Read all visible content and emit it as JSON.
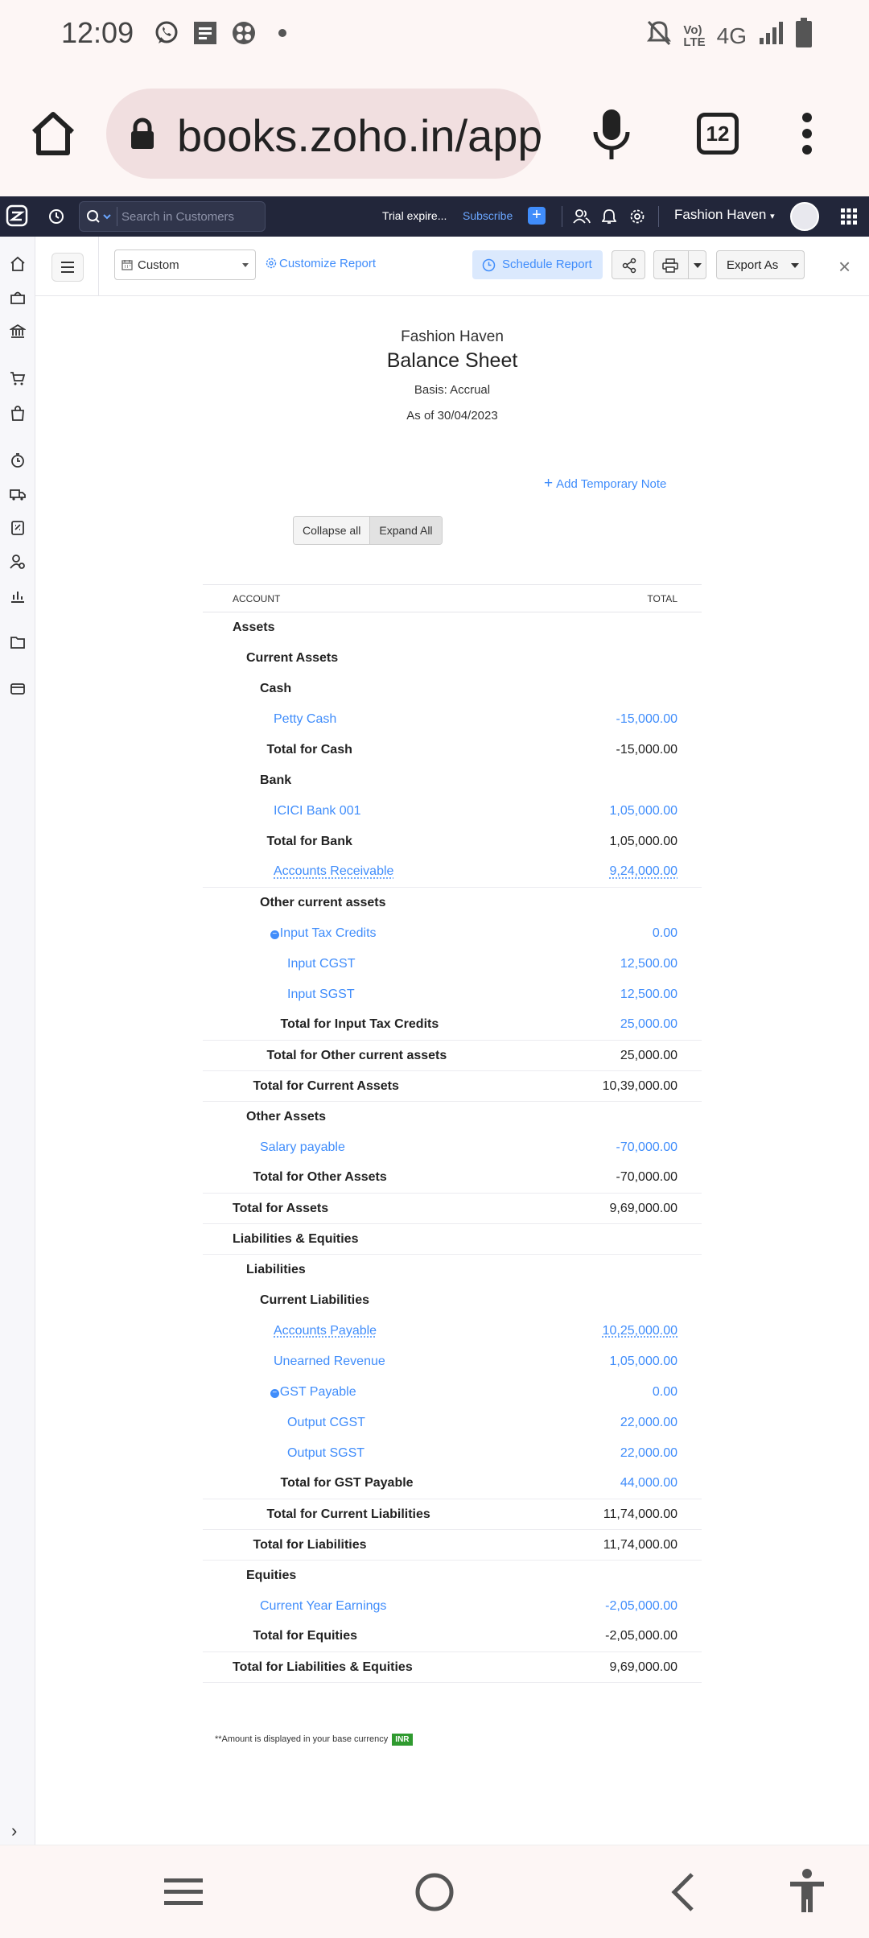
{
  "status_bar": {
    "time": "12:09",
    "network": "4G"
  },
  "browser": {
    "url": "books.zoho.in/app",
    "tab_count": "12"
  },
  "topbar": {
    "search_placeholder": "Search in Customers",
    "trial": "Trial expire...",
    "subscribe": "Subscribe",
    "org_name": "Fashion Haven"
  },
  "toolbar": {
    "period": "Custom",
    "customize": "Customize Report",
    "schedule": "Schedule Report",
    "export": "Export As"
  },
  "report": {
    "org": "Fashion Haven",
    "title": "Balance Sheet",
    "basis": "Basis: Accrual",
    "as_of": "As of 30/04/2023",
    "add_note": "Add Temporary Note",
    "collapse_all": "Collapse all",
    "expand_all": "Expand All",
    "col_account": "Account",
    "col_total": "Total",
    "footnote": "**Amount is displayed in your base currency",
    "currency": "INR"
  },
  "rows": [
    {
      "label": "Assets",
      "amount": "",
      "indent": 1,
      "type": "header"
    },
    {
      "label": "Current Assets",
      "amount": "",
      "indent": 2,
      "type": "header"
    },
    {
      "label": "Cash",
      "amount": "",
      "indent": 3,
      "type": "header"
    },
    {
      "label": "Petty Cash",
      "amount": "-15,000.00",
      "indent": 4,
      "type": "link"
    },
    {
      "label": "Total for Cash",
      "amount": "-15,000.00",
      "indent": 3.5,
      "type": "total"
    },
    {
      "label": "Bank",
      "amount": "",
      "indent": 3,
      "type": "header"
    },
    {
      "label": "ICICI Bank 001",
      "amount": "1,05,000.00",
      "indent": 4,
      "type": "link"
    },
    {
      "label": "Total for Bank",
      "amount": "1,05,000.00",
      "indent": 3.5,
      "type": "total"
    },
    {
      "label": "Accounts Receivable",
      "amount": "9,24,000.00",
      "indent": 4,
      "type": "link-underline"
    },
    {
      "label": "Other current assets",
      "amount": "",
      "indent": 3,
      "type": "header"
    },
    {
      "label": "Input Tax Credits",
      "amount": "0.00",
      "indent": 3.75,
      "type": "link-collapsible"
    },
    {
      "label": "Input CGST",
      "amount": "12,500.00",
      "indent": 5,
      "type": "link"
    },
    {
      "label": "Input SGST",
      "amount": "12,500.00",
      "indent": 5,
      "type": "link"
    },
    {
      "label": "Total for Input Tax Credits",
      "amount": "25,000.00",
      "indent": 4.5,
      "type": "total-link"
    },
    {
      "label": "Total for Other current assets",
      "amount": "25,000.00",
      "indent": 3.5,
      "type": "total"
    },
    {
      "label": "Total for Current Assets",
      "amount": "10,39,000.00",
      "indent": 2.5,
      "type": "total"
    },
    {
      "label": "Other Assets",
      "amount": "",
      "indent": 2,
      "type": "header"
    },
    {
      "label": "Salary payable",
      "amount": "-70,000.00",
      "indent": 3,
      "type": "link"
    },
    {
      "label": "Total for Other Assets",
      "amount": "-70,000.00",
      "indent": 2.5,
      "type": "total"
    },
    {
      "label": "Total for Assets",
      "amount": "9,69,000.00",
      "indent": 1,
      "type": "total"
    },
    {
      "label": "Liabilities & Equities",
      "amount": "",
      "indent": 1,
      "type": "header"
    },
    {
      "label": "Liabilities",
      "amount": "",
      "indent": 2,
      "type": "header"
    },
    {
      "label": "Current Liabilities",
      "amount": "",
      "indent": 3,
      "type": "header"
    },
    {
      "label": "Accounts Payable",
      "amount": "10,25,000.00",
      "indent": 4,
      "type": "link-underline"
    },
    {
      "label": "Unearned Revenue",
      "amount": "1,05,000.00",
      "indent": 4,
      "type": "link"
    },
    {
      "label": "GST Payable",
      "amount": "0.00",
      "indent": 3.75,
      "type": "link-collapsible"
    },
    {
      "label": "Output CGST",
      "amount": "22,000.00",
      "indent": 5,
      "type": "link"
    },
    {
      "label": "Output SGST",
      "amount": "22,000.00",
      "indent": 5,
      "type": "link"
    },
    {
      "label": "Total for GST Payable",
      "amount": "44,000.00",
      "indent": 4.5,
      "type": "total-link"
    },
    {
      "label": "Total for Current Liabilities",
      "amount": "11,74,000.00",
      "indent": 3.5,
      "type": "total"
    },
    {
      "label": "Total for Liabilities",
      "amount": "11,74,000.00",
      "indent": 2.5,
      "type": "total"
    },
    {
      "label": "Equities",
      "amount": "",
      "indent": 2,
      "type": "header"
    },
    {
      "label": "Current Year Earnings",
      "amount": "-2,05,000.00",
      "indent": 3,
      "type": "link"
    },
    {
      "label": "Total for Equities",
      "amount": "-2,05,000.00",
      "indent": 2.5,
      "type": "total"
    },
    {
      "label": "Total for Liabilities & Equities",
      "amount": "9,69,000.00",
      "indent": 1,
      "type": "total"
    }
  ]
}
